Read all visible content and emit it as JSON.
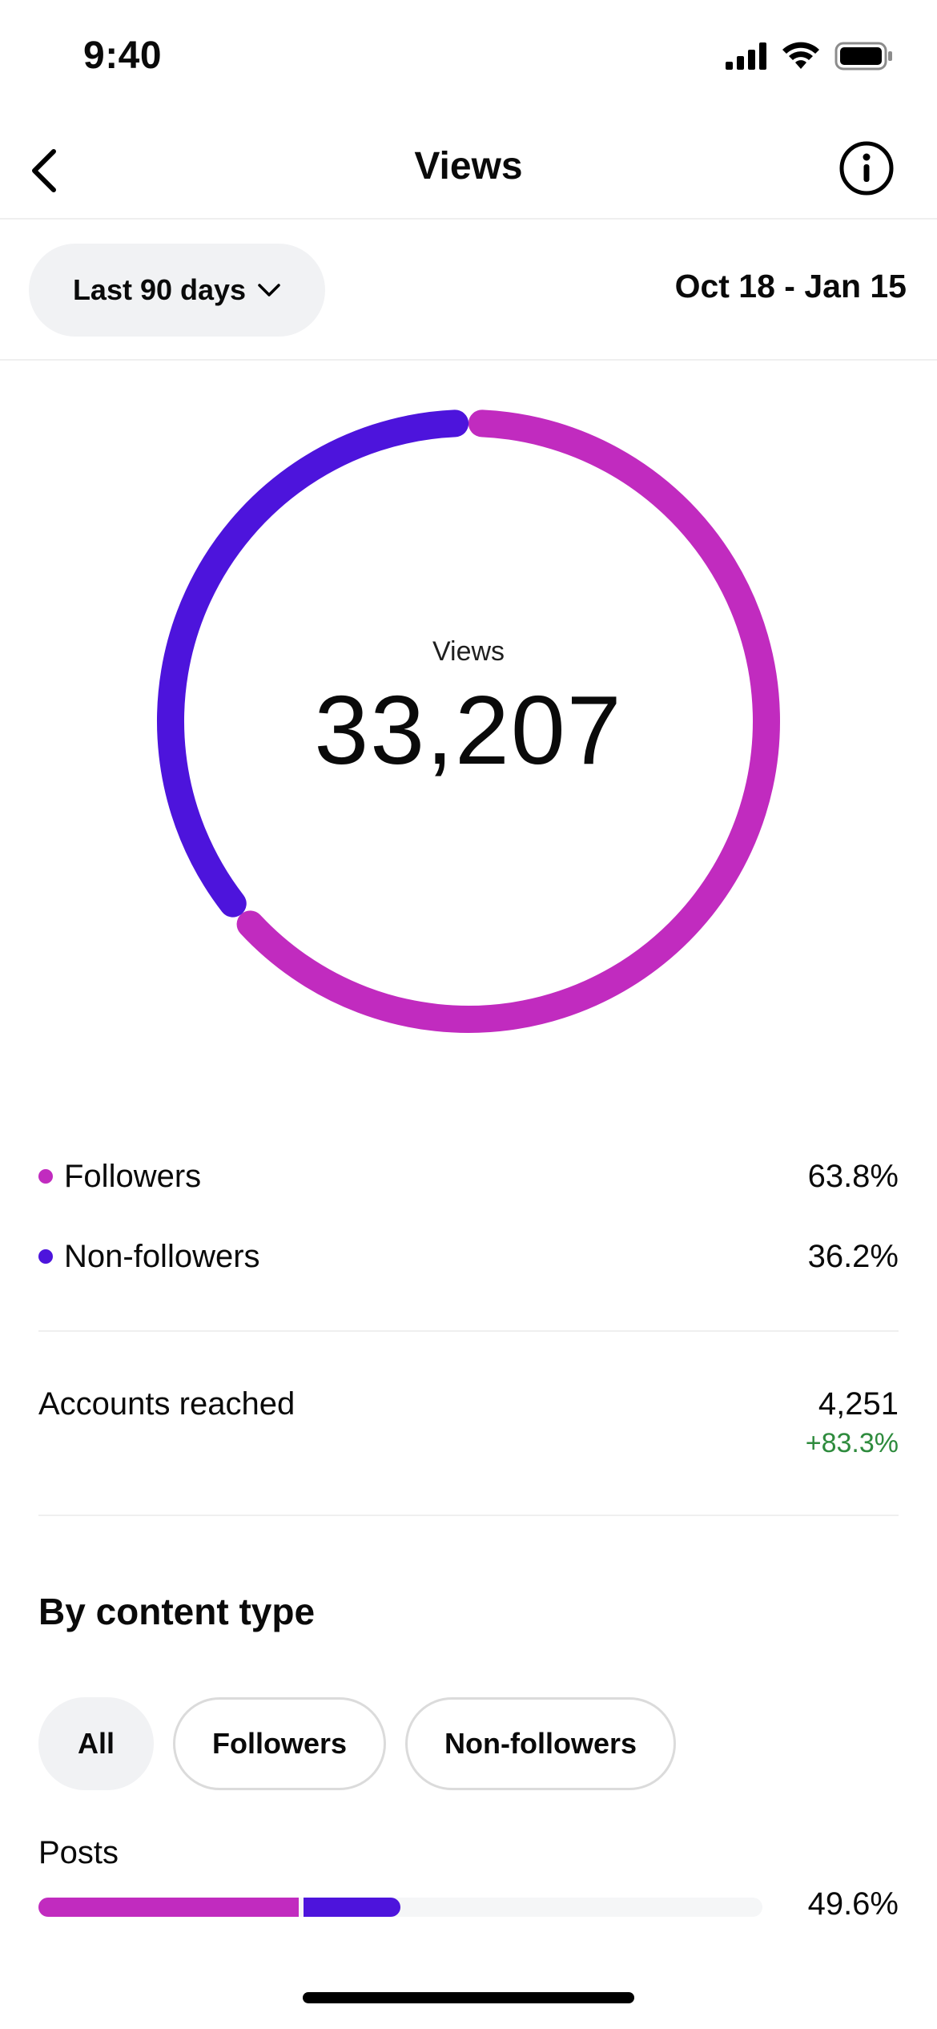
{
  "status_bar": {
    "time": "9:40"
  },
  "nav": {
    "title": "Views"
  },
  "filter": {
    "range_label": "Last 90 days",
    "date_range": "Oct 18 - Jan 15"
  },
  "summary": {
    "label": "Views",
    "total": "33,207"
  },
  "colors": {
    "followers": "#c12bbf",
    "non_followers": "#4d14dc",
    "positive": "#2e8b3d"
  },
  "chart_data": {
    "type": "pie",
    "labels": [
      "Followers",
      "Non-followers"
    ],
    "values": [
      63.8,
      36.2
    ]
  },
  "legend": [
    {
      "label": "Followers",
      "value": "63.8%"
    },
    {
      "label": "Non-followers",
      "value": "36.2%"
    }
  ],
  "accounts_reached": {
    "label": "Accounts reached",
    "value": "4,251",
    "change": "+83.3%"
  },
  "content_type": {
    "title": "By content type",
    "chips": [
      "All",
      "Followers",
      "Non-followers"
    ],
    "selected_chip": "All",
    "rows": [
      {
        "label": "Posts",
        "value": "49.6%",
        "followers_fraction": 0.36,
        "non_followers_fraction": 0.14
      }
    ]
  }
}
